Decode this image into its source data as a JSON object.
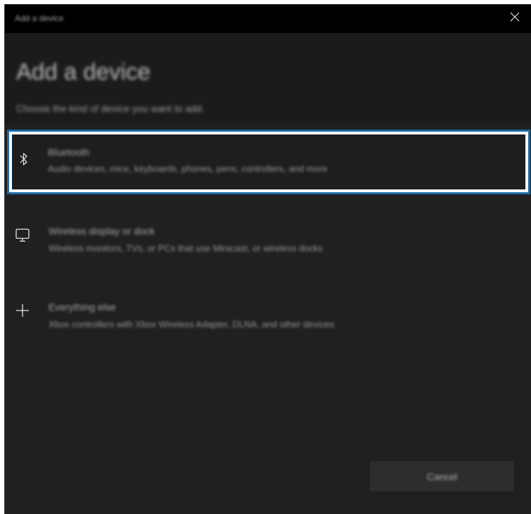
{
  "window": {
    "title": "Add a device",
    "close_icon": "close-icon"
  },
  "header": {
    "heading": "Add a device",
    "subheading": "Choose the kind of device you want to add."
  },
  "options": [
    {
      "name": "Bluetooth",
      "description": "Audio devices, mice, keyboards, phones, pens, controllers, and more",
      "icon": "bluetooth-icon",
      "selected": true
    },
    {
      "name": "Wireless display or dock",
      "description": "Wireless monitors, TVs, or PCs that use Miracast, or wireless docks",
      "icon": "monitor-icon",
      "selected": false
    },
    {
      "name": "Everything else",
      "description": "Xbox controllers with Xbox Wireless Adapter, DLNA, and other devices",
      "icon": "plus-icon",
      "selected": false
    }
  ],
  "footer": {
    "cancel_label": "Cancel"
  },
  "colors": {
    "background": "#202020",
    "titlebar": "#000000",
    "focus_ring": "#1a6aa5"
  }
}
